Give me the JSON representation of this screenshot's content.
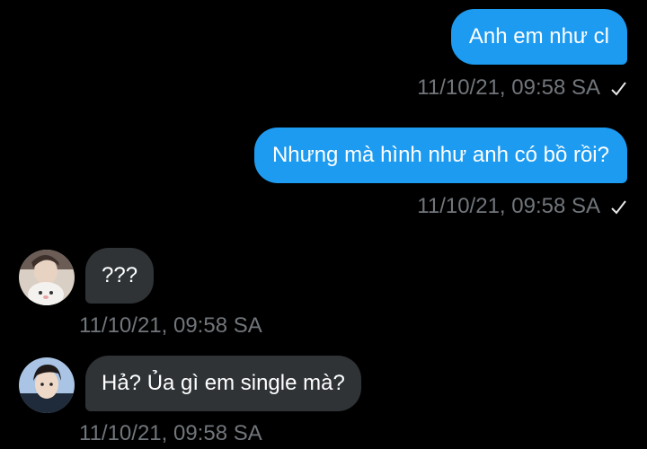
{
  "messages": [
    {
      "direction": "outgoing",
      "text": "Anh em như cl",
      "timestamp": "11/10/21, 09:58 SA",
      "status_icon": "check-icon"
    },
    {
      "direction": "outgoing",
      "text": "Nhưng mà hình như anh có bồ rồi?",
      "timestamp": "11/10/21, 09:58 SA",
      "status_icon": "check-icon"
    },
    {
      "direction": "incoming",
      "text": "???",
      "timestamp": "11/10/21, 09:58 SA",
      "avatar": "user-avatar"
    },
    {
      "direction": "incoming",
      "text": "Hả? Ủa gì em single mà?",
      "timestamp": "11/10/21, 09:58 SA",
      "avatar": "user-avatar"
    }
  ],
  "colors": {
    "background": "#000000",
    "outgoing_bubble": "#1d9bf0",
    "incoming_bubble": "#2f3336",
    "timestamp_text": "#71767b"
  }
}
